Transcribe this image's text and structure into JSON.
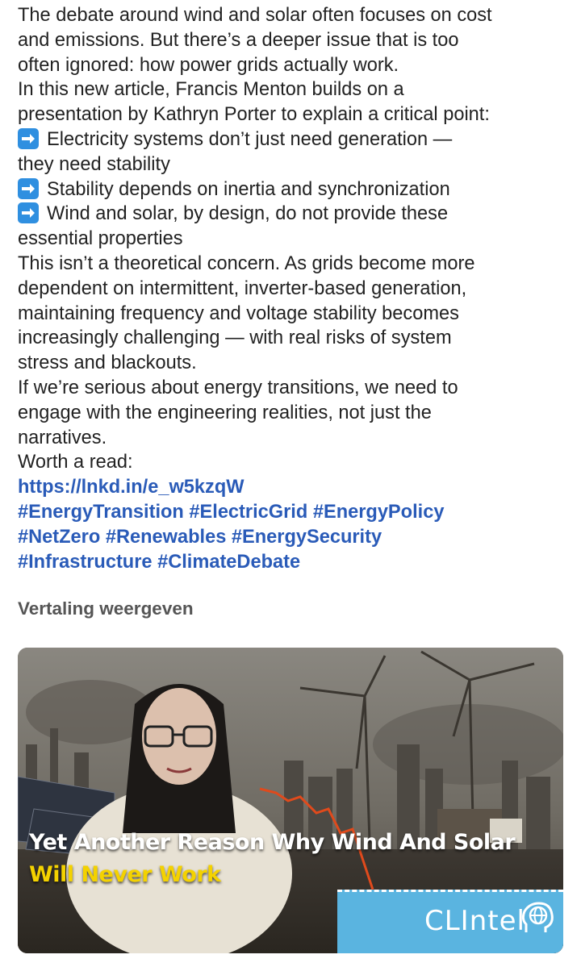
{
  "post": {
    "paragraphs": [
      "The debate around wind and solar often focuses on cost",
      "and emissions. But there’s a deeper issue that is too",
      "often ignored: how power grids actually work.",
      "In this new article, Francis Menton builds on a",
      "presentation by Kathryn Porter to explain a critical point:"
    ],
    "bullets": [
      {
        "first": "Electricity systems don’t just need generation —",
        "rest": "they need stability"
      },
      {
        "first": "Stability depends on inertia and synchronization",
        "rest": ""
      },
      {
        "first": "Wind and solar, by design, do not provide these",
        "rest": "essential properties"
      }
    ],
    "after": [
      "This isn’t a theoretical concern. As grids become more",
      "dependent on intermittent, inverter-based generation,",
      "maintaining frequency and voltage stability becomes",
      "increasingly challenging — with real risks of system",
      "stress and blackouts.",
      "If we’re serious about energy transitions, we need to",
      "engage with the engineering realities, not just the",
      "narratives.",
      "Worth a read:"
    ],
    "link": "https://lnkd.in/e_w5kzqW",
    "hashtags": [
      "#EnergyTransition #ElectricGrid #EnergyPolicy",
      "#NetZero #Renewables #EnergySecurity",
      "#Infrastructure #ClimateDebate"
    ],
    "translate_label": "Vertaling weergeven"
  },
  "card": {
    "headline_line1": "Yet Another Reason Why Wind And Solar",
    "headline_line2": "Will Never Work",
    "brand": "CLIntel",
    "accent_yellow": "#f4d200",
    "brand_color": "#5ab4e0",
    "link_color": "#2a5bb8"
  }
}
